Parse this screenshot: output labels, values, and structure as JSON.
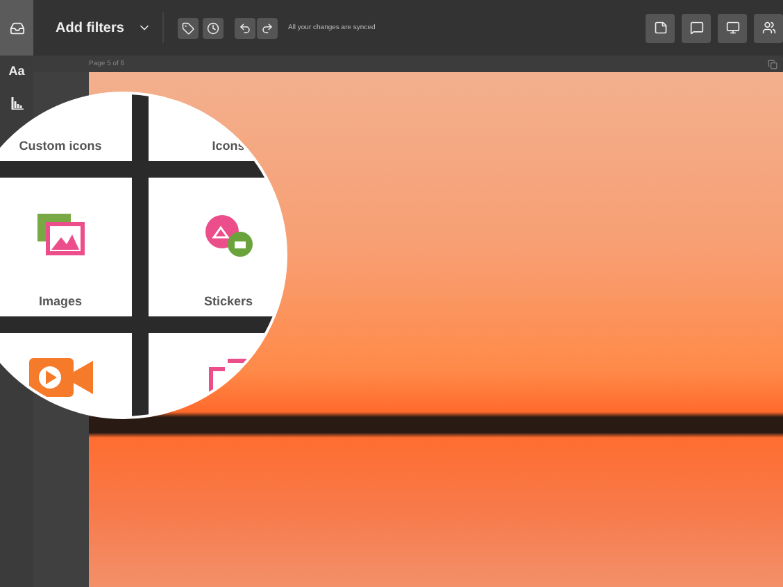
{
  "toolbar": {
    "filter_label": "Add filters",
    "sync_status": "All your changes are synced"
  },
  "sidebar": {
    "font_label": "Aa"
  },
  "page": {
    "indicator": "Page 5 of 6"
  },
  "zoom_panel": {
    "tiles": [
      {
        "label": "Custom icons",
        "kind": "none"
      },
      {
        "label": "Icons",
        "kind": "none"
      },
      {
        "label": "Images",
        "kind": "images"
      },
      {
        "label": "Stickers",
        "kind": "stickers"
      },
      {
        "kind": "video"
      },
      {
        "kind": "frames"
      }
    ]
  }
}
